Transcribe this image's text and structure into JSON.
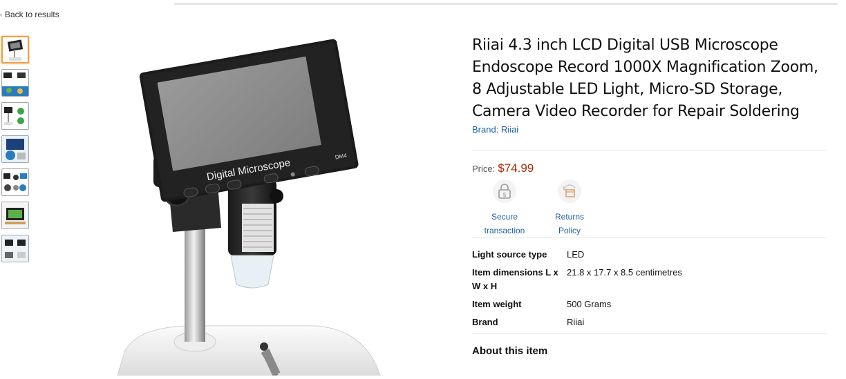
{
  "nav": {
    "back_label": "Back to results"
  },
  "product": {
    "title": "Riiai 4.3 inch LCD Digital USB Microscope Endoscope Record 1000X Magnification Zoom, 8 Adjustable LED Light, Micro-SD Storage, Camera Video Recorder for Repair Soldering",
    "brand_link": "Brand: Riiai",
    "price_label": "Price:",
    "price": "$74.99",
    "screen_text": "Digital Microscope",
    "screen_badge": "DM4"
  },
  "badges": [
    {
      "icon": "lock-icon",
      "label": "Secure transaction"
    },
    {
      "icon": "returns-box-icon",
      "label": "Returns Policy"
    }
  ],
  "specs": [
    {
      "key": "Light source type",
      "value": "LED"
    },
    {
      "key": "Item dimensions L x W x H",
      "value": "21.8 x 17.7 x 8.5 centimetres"
    },
    {
      "key": "Item weight",
      "value": "500 Grams"
    },
    {
      "key": "Brand",
      "value": "Riiai"
    }
  ],
  "about_heading": "About this item",
  "colors": {
    "price": "#b12704",
    "link": "#2162a1",
    "selected_thumb": "#f0a040"
  }
}
